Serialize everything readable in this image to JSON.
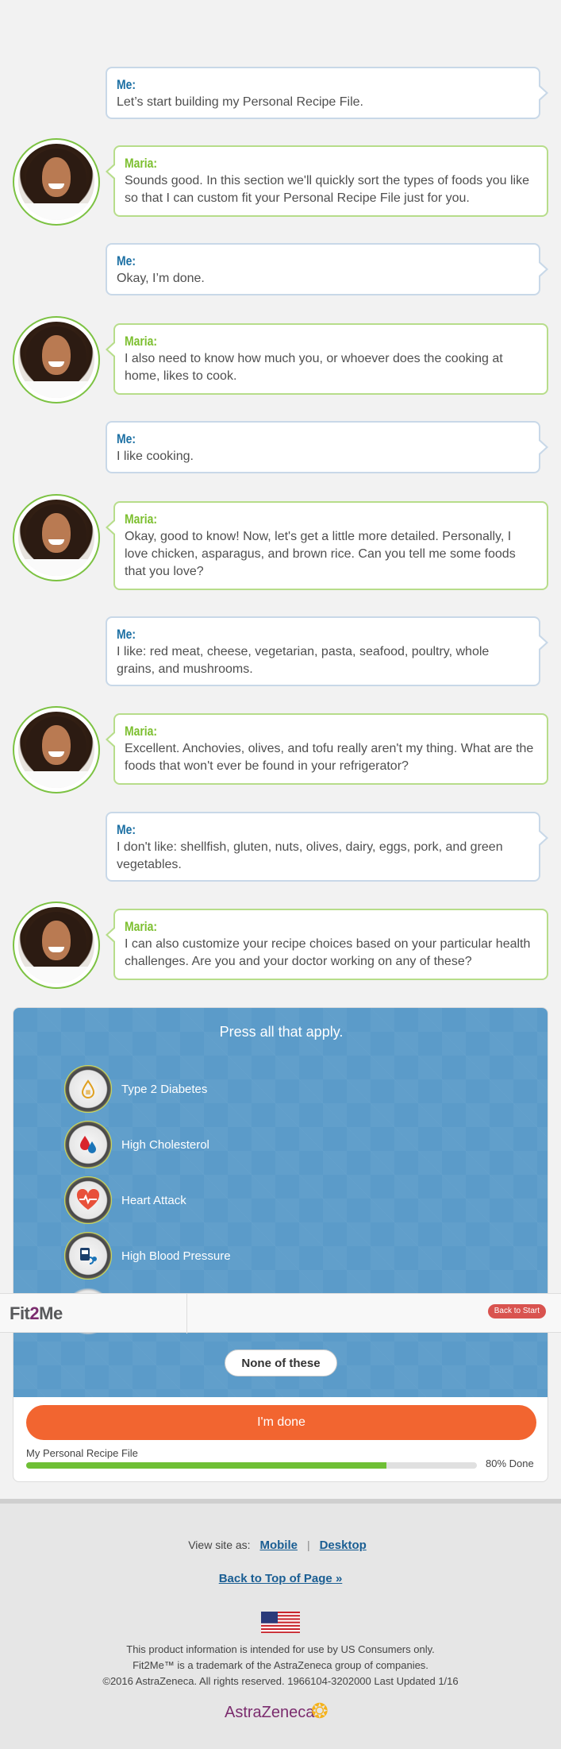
{
  "chat": [
    {
      "speaker": "Me:",
      "text": "Let’s start building my Personal Recipe File."
    },
    {
      "speaker": "Maria:",
      "text": "Sounds good. In this section we'll quickly sort the types of foods you like so that I can custom fit your Personal Recipe File just for you."
    },
    {
      "speaker": "Me:",
      "text": "Okay, I’m done."
    },
    {
      "speaker": "Maria:",
      "text": "I also need to know how much you, or whoever does the cooking at home, likes to cook."
    },
    {
      "speaker": "Me:",
      "text": "I like cooking."
    },
    {
      "speaker": "Maria:",
      "text": "Okay, good to know! Now, let's get a little more detailed. Personally, I love chicken, asparagus, and brown rice. Can you tell me some foods that you love?"
    },
    {
      "speaker": "Me:",
      "text": "I like: red meat, cheese, vegetarian, pasta, seafood, poultry, whole grains, and mushrooms."
    },
    {
      "speaker": "Maria:",
      "text": "Excellent. Anchovies, olives, and tofu really aren't my thing. What are the foods that won't ever be found in your refrigerator?"
    },
    {
      "speaker": "Me:",
      "text": "I don't like: shellfish, gluten, nuts, olives, dairy, eggs, pork, and green vegetables."
    },
    {
      "speaker": "Maria:",
      "text": "I can also customize your recipe choices based on your particular health challenges. Are you and your doctor working on any of these?"
    }
  ],
  "panel": {
    "prompt": "Press all that apply.",
    "options": [
      {
        "label": "Type 2 Diabetes",
        "icon": "diabetes-icon"
      },
      {
        "label": "High Cholesterol",
        "icon": "cholesterol-icon"
      },
      {
        "label": "Heart Attack",
        "icon": "heart-icon"
      },
      {
        "label": "High Blood Pressure",
        "icon": "blood-pressure-icon"
      }
    ],
    "none_label": "None of these",
    "done_label": "I'm done",
    "progress_label": "My Personal Recipe File",
    "progress_percent": 80,
    "progress_text": "80% Done"
  },
  "sticky": {
    "logo_a": "Fit",
    "logo_b": "2",
    "logo_c": "Me",
    "back_to_start": "Back to Start"
  },
  "footer": {
    "view_site_as": "View site as:",
    "mobile": "Mobile",
    "sep": "|",
    "desktop": "Desktop",
    "back_to_top": "Back to Top of Page »",
    "line1": "This product information is intended for use by US Consumers only.",
    "line2": "Fit2Me™ is a trademark of the AstraZeneca group of companies.",
    "line3": "©2016 AstraZeneca. All rights reserved. 1966104-3202000 Last Updated 1/16",
    "brand": "AstraZeneca"
  },
  "colors": {
    "me_accent": "#1b6fa3",
    "maria_accent": "#7cbf2f",
    "panel_blue": "#5b9bc9",
    "done_orange": "#f26530",
    "progress_green": "#6fbf35"
  }
}
